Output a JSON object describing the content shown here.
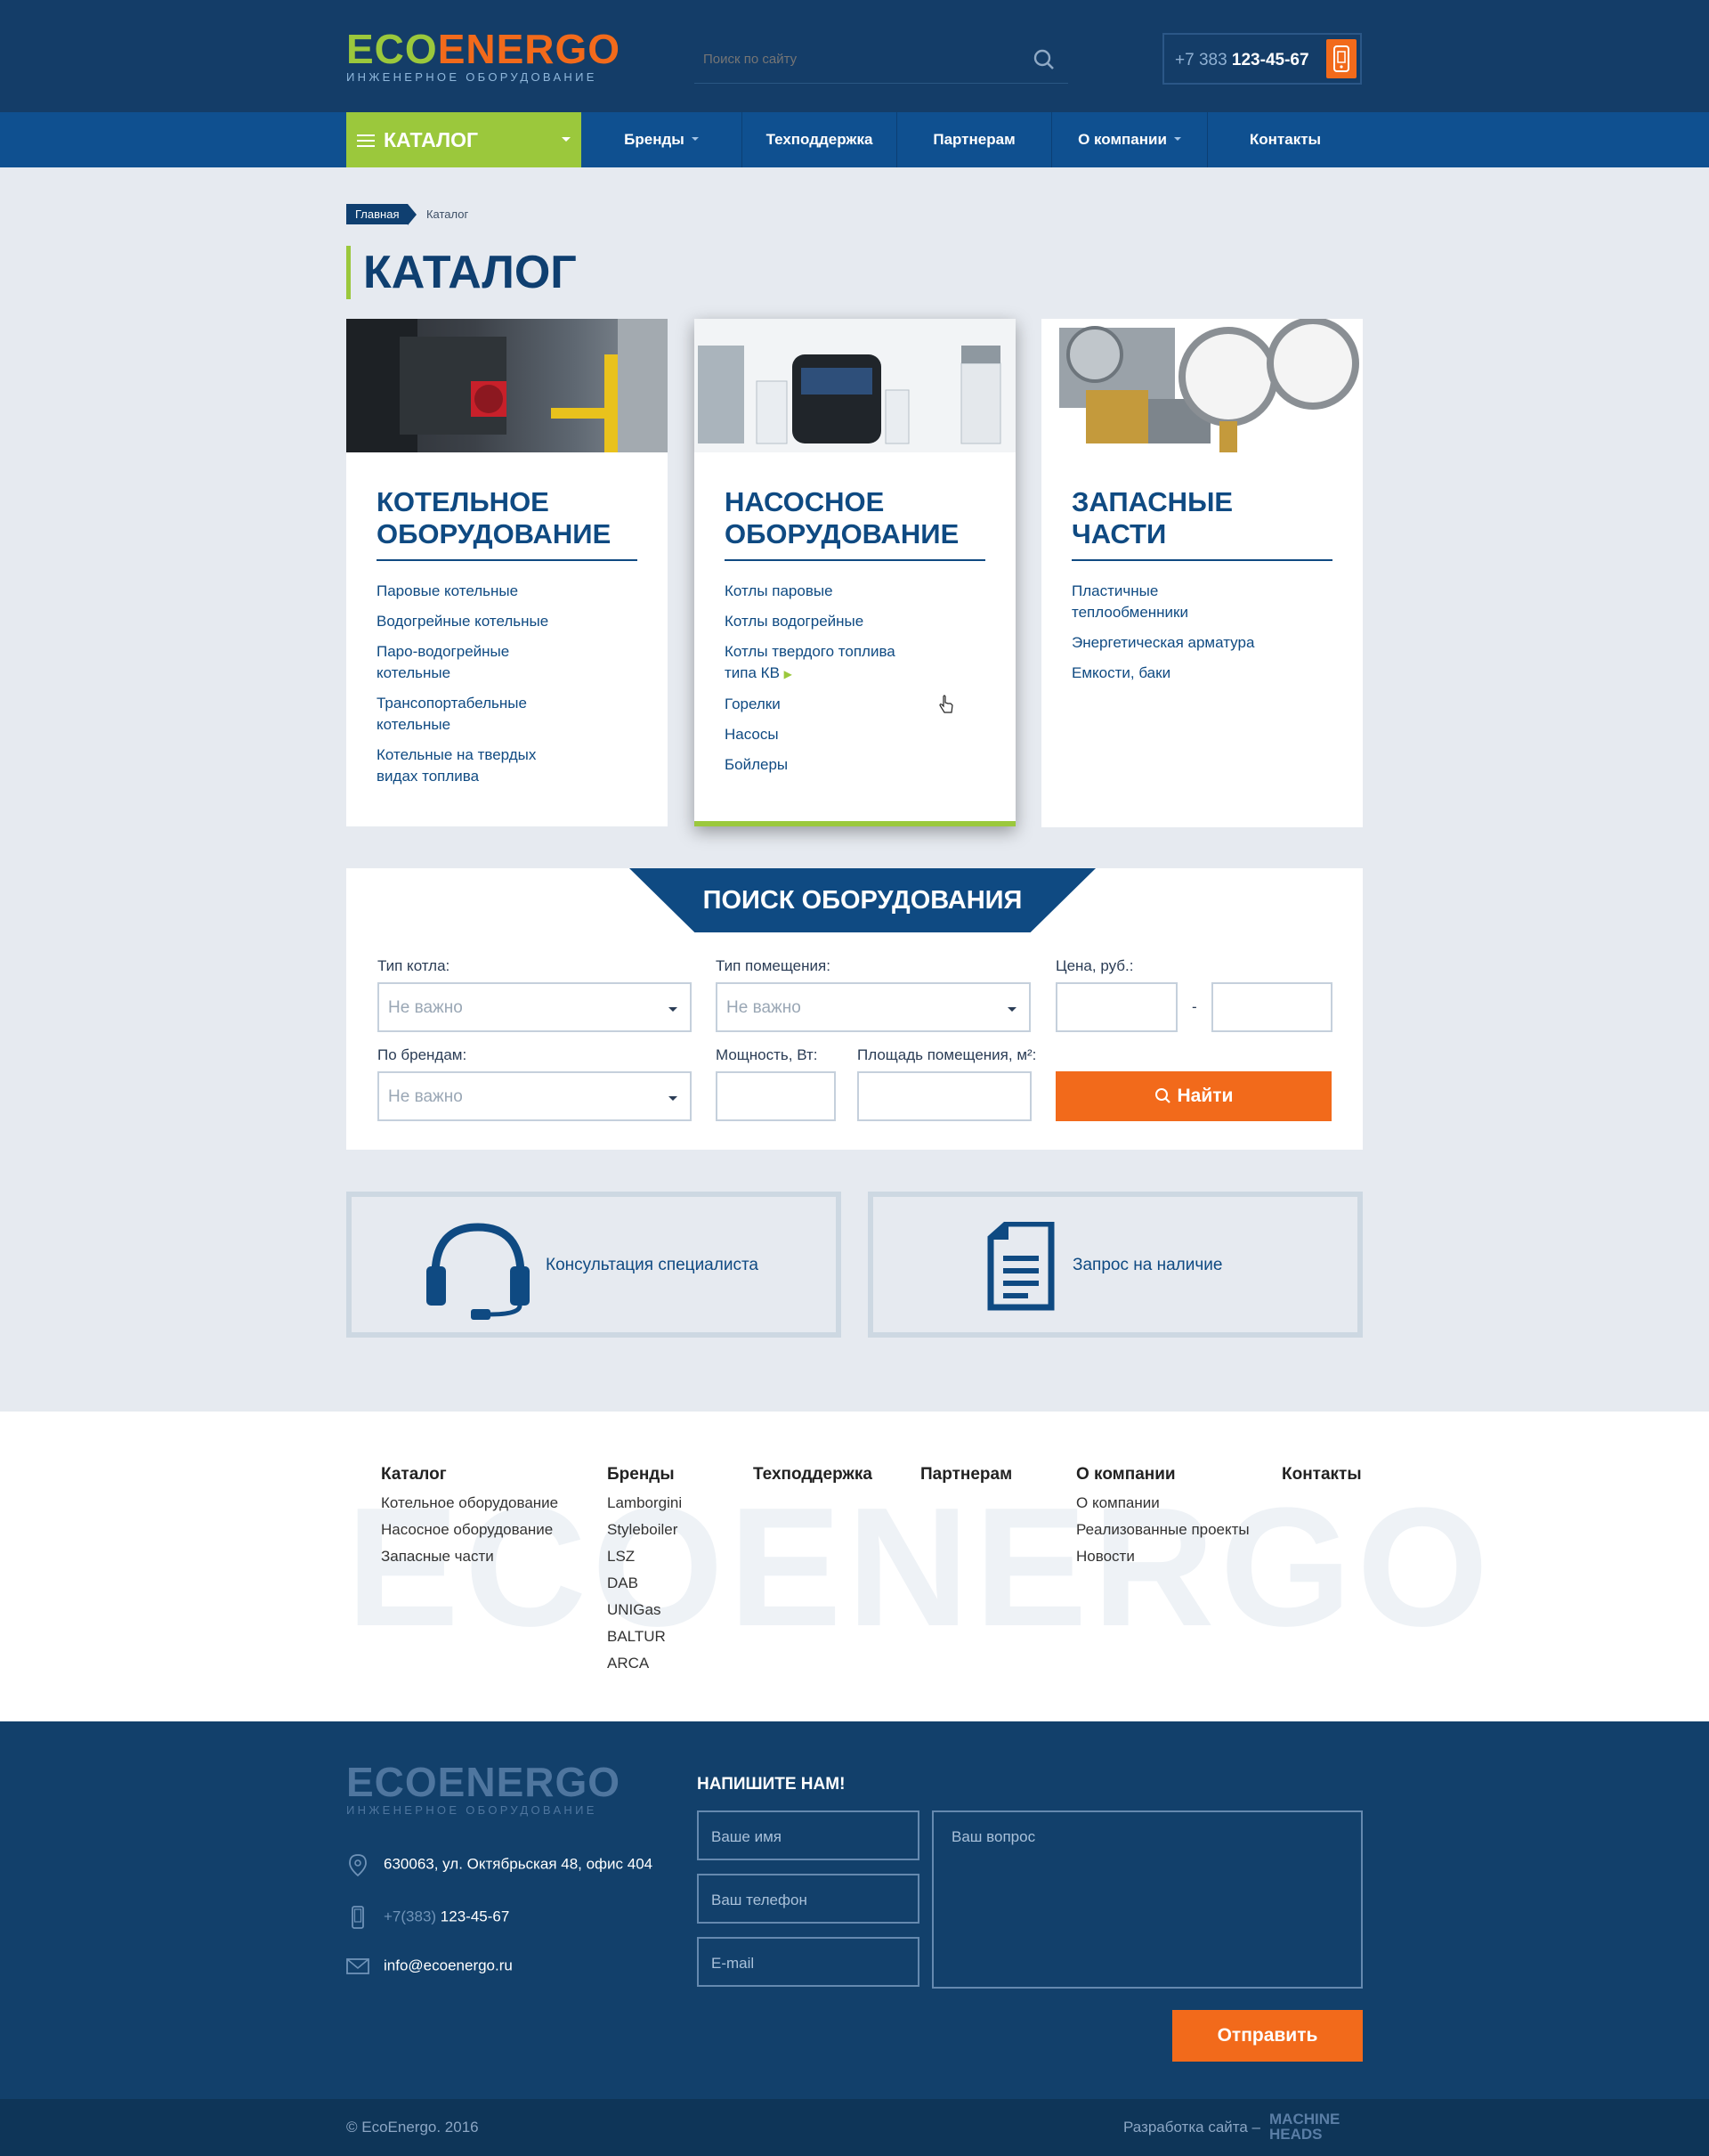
{
  "header": {
    "logo_eco": "ECO",
    "logo_energo": "ENERGO",
    "logo_sub": "ИНЖЕНЕРНОЕ ОБОРУДОВАНИЕ",
    "search_placeholder": "Поиск по сайту",
    "phone_code": "+7 383 ",
    "phone_number": "123-45-67"
  },
  "nav": {
    "catalog": "КАТАЛОГ",
    "items": [
      "Бренды",
      "Техподдержка",
      "Партнерам",
      "О компании",
      "Контакты"
    ]
  },
  "breadcrumb": {
    "home": "Главная",
    "current": "Каталог"
  },
  "page_title": "КАТАЛОГ",
  "cards": [
    {
      "title": "КОТЕЛЬНОЕ ОБОРУДОВАНИЕ",
      "links": [
        "Паровые котельные",
        "Водогрейные котельные",
        "Паро-водогрейные котельные",
        "Трансопортабельные котельные",
        "Котельные на твердых видах топлива"
      ]
    },
    {
      "title": "НАСОСНОЕ ОБОРУДОВАНИЕ",
      "links": [
        "Котлы паровые",
        "Котлы водогрейные",
        "Котлы твердого топлива типа КВ",
        "Горелки",
        "Насосы",
        "Бойлеры"
      ]
    },
    {
      "title": "ЗАПАСНЫЕ ЧАСТИ",
      "links": [
        "Пластичные теплообменники",
        "Энергетическая арматура",
        "Емкости, баки"
      ]
    }
  ],
  "search_form": {
    "title": "ПОИСК ОБОРУДОВАНИЯ",
    "boiler_type_label": "Тип котла:",
    "room_type_label": "Тип помещения:",
    "price_label": "Цена, руб.:",
    "brands_label": "По брендам:",
    "power_label": "Мощность, Вт:",
    "area_label": "Площадь помещения, м²:",
    "any": "Не важно",
    "dash": "-",
    "find": "Найти"
  },
  "actions": {
    "consult": "Консультация специалиста",
    "request": "Запрос на наличие"
  },
  "footer_links": {
    "watermark": "ECOENERGO",
    "catalog": {
      "head": "Каталог",
      "items": [
        "Котельное оборудование",
        "Насосное оборудование",
        "Запасные части"
      ]
    },
    "brands": {
      "head": "Бренды",
      "items": [
        "Lamborgini",
        "Styleboiler",
        "LSZ",
        "DAB",
        "UNIGas",
        "BALTUR",
        "ARCA"
      ]
    },
    "support": {
      "head": "Техподдержка"
    },
    "partners": {
      "head": "Партнерам"
    },
    "company": {
      "head": "О компании",
      "items": [
        "О компании",
        "Реализованные проекты",
        "Новости"
      ]
    },
    "contacts": {
      "head": "Контакты"
    }
  },
  "bottom": {
    "logo_word": "ECOENERGO",
    "logo_sub": "ИНЖЕНЕРНОЕ ОБОРУДОВАНИЕ",
    "address": "630063, ул. Октябрьская 48, офис 404",
    "phone_code": "+7(383) ",
    "phone_number": "123-45-67",
    "email": "info@ecoenergo.ru",
    "write_us": "НАПИШИТЕ НАМ!",
    "name_ph": "Ваше имя",
    "phone_ph": "Ваш телефон",
    "email_ph": "E-mail",
    "question_ph": "Ваш вопрос",
    "send": "Отправить"
  },
  "copyright": {
    "left": "© EcoEnergo. 2016",
    "dev": "Разработка сайта –",
    "studio_1": "MACHINE",
    "studio_2": "HEADS"
  },
  "colors": {
    "primary": "#0f4a82",
    "dark": "#143d68",
    "green": "#9bc83c",
    "orange": "#f26a1b"
  }
}
